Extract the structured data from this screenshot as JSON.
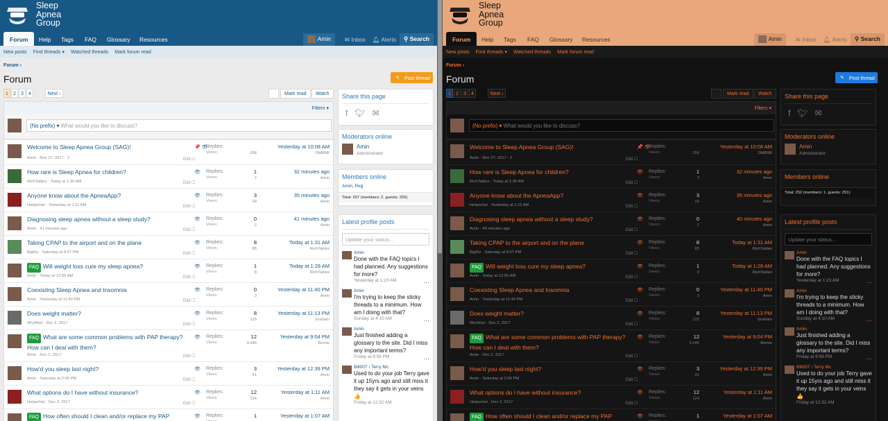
{
  "site": {
    "logo_lines": [
      "Sleep",
      "Apnea",
      "Group"
    ]
  },
  "nav": {
    "tabs": [
      "Forum",
      "Help",
      "Tags",
      "FAQ",
      "Glossary",
      "Resources"
    ],
    "user": "Amin",
    "inbox": "Inbox",
    "alerts": "Alerts",
    "search": "Search"
  },
  "subnav": [
    "New posts",
    "Find threads ▾",
    "Watched threads",
    "Mark forum read"
  ],
  "breadcrumb": "Forum ›",
  "page_title": "Forum",
  "post_thread": "Post thread",
  "pager": {
    "pages": [
      "1",
      "2",
      "3",
      "4"
    ],
    "next": "Next ›"
  },
  "mark_read": "Mark read",
  "watch": "Watch",
  "filters": "Filters ▾",
  "quick_thread": {
    "prefix": "(No prefix) ▾",
    "placeholder": "What would you like to discuss?"
  },
  "labels": {
    "replies": "Replies:",
    "views": "Views:",
    "edit": "Edit"
  },
  "faq_tag": "FAQ",
  "threads": [
    {
      "title": "Welcome to Sleep Apnea Group (SAG)!",
      "meta": "Amin · Nov 27, 2017 · 2",
      "replies": "",
      "views": "258",
      "last": "Yesterday at 10:08 AM",
      "last_user": "DMB9R",
      "sticky": true
    },
    {
      "title": "How rare is Sleep Apnea for children?",
      "meta": "RichTablex · Today at 1:35 AM",
      "replies": "1",
      "views": "2",
      "last": "32 minutes ago",
      "last_user": "Amin"
    },
    {
      "title": "Anyone know about the ApneaApp?",
      "meta": "HelperHal · Yesterday at 1:11 AM",
      "replies": "3",
      "views": "24",
      "last": "35 minutes ago",
      "last_user": "Amin"
    },
    {
      "title": "Diagnosing sleep apnea without a sleep study?",
      "meta": "Amin · 41 minutes ago",
      "replies": "0",
      "views": "2",
      "last": "41 minutes ago",
      "last_user": "Amin"
    },
    {
      "title": "Taking CPAP to the airport and on the plane",
      "meta": "BigKiz · Saturday at 8:57 PM",
      "replies": "8",
      "views": "85",
      "last": "Today at 1:31 AM",
      "last_user": "RichTablex"
    },
    {
      "title": "Will weight loss cure my sleep apnea?",
      "meta": "Amin · Today at 12:55 AM",
      "replies": "1",
      "views": "8",
      "last": "Today at 1:28 AM",
      "last_user": "RichTablex",
      "faq": true
    },
    {
      "title": "Coexisting Sleep Apnea and Insomnia",
      "meta": "Amin · Yesterday at 11:40 PM",
      "replies": "0",
      "views": "3",
      "last": "Yesterday at 11:40 PM",
      "last_user": "Amin"
    },
    {
      "title": "Does weight matter?",
      "meta": "WryWart · Dec 2, 2017",
      "replies": "8",
      "views": "125",
      "last": "Yesterday at 11:13 PM",
      "last_user": "Graham"
    },
    {
      "title": "What are some common problems with PAP therapy? How can I deal with them?",
      "meta": "Amin · Dec 2, 2017",
      "replies": "12",
      "views": "3,046",
      "last": "Yesterday at 9:04 PM",
      "last_user": "Bernie",
      "faq": true
    },
    {
      "title": "How'd you sleep last night?",
      "meta": "Amin · Saturday at 2:59 PM",
      "replies": "3",
      "views": "41",
      "last": "Yesterday at 12:39 PM",
      "last_user": "Amin"
    },
    {
      "title": "What options do I have without insurance?",
      "meta": "HelperHal · Dec 2, 2017",
      "replies": "12",
      "views": "124",
      "last": "Yesterday at 1:11 AM",
      "last_user": "Amin"
    },
    {
      "title": "How often should I clean and/or replace my PAP",
      "meta": "",
      "replies": "1",
      "views": "",
      "last": "Yesterday at 1:07 AM",
      "last_user": "",
      "faq": true
    }
  ],
  "sidebar": {
    "share_title": "Share this page",
    "moderators_title": "Moderators online",
    "moderator": {
      "name": "Amin",
      "role": "Administrator"
    },
    "members_title": "Members online",
    "members_list": "Amin, Reg",
    "totals_light": "Total: 257 (members: 2, guests: 255)",
    "totals_dark": "Total: 252 (members: 1, guests: 251)",
    "profile_title": "Latest profile posts",
    "status_placeholder": "Update your status...",
    "posts": [
      {
        "who": "Amin",
        "msg": "Done with the FAQ topics I had planned. Any suggestions for more?",
        "time": "Yesterday at 1:23 AM"
      },
      {
        "who": "Amin",
        "msg": "I'm trying to keep the sticky threads to a minimum. How am I doing with that?",
        "time": "Sunday at 4:10 AM"
      },
      {
        "who": "Amin",
        "msg": "Just finished adding a glossary to the site. Did I miss any important terms?",
        "time": "Friday at 9:58 PM"
      },
      {
        "who": "Bill007 › Terry Mc",
        "msg": "Used to do your job Terry gave it up 15yrs ago and still miss it they say it gets in your veins 👍",
        "time": "Friday at 12:32 AM"
      }
    ]
  },
  "dark_overrides": {
    "thread_times": [
      "Yesterday at 10:08 AM",
      "32 minutes ago",
      "35 minutes ago",
      "40 minutes ago"
    ],
    "metas": [
      "Amin · Nov 27, 2017 · 2",
      "RichTablex · Today at 1:35 AM",
      "HelperHal · Yesterday at 1:11 AM",
      "Amin · 40 minutes ago"
    ]
  },
  "colors": {
    "light_header": "#185886",
    "dark_header": "#e8a87c",
    "accent_orange": "#f39c1c",
    "dark_accent": "#f07030",
    "blue_button": "#1f7ae0",
    "faq_green": "#1f9c3c"
  }
}
